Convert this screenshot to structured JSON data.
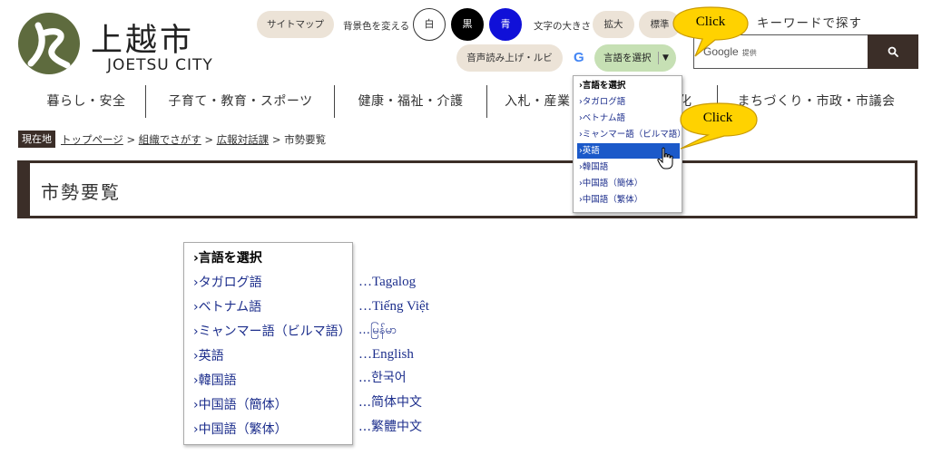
{
  "logo": {
    "kanji": "上越市",
    "roman": "JOETSU CITY"
  },
  "top": {
    "sitemap": "サイトマップ",
    "bg_label": "背景色を変える",
    "bg_white": "白",
    "bg_black": "黒",
    "bg_blue": "青",
    "font_label": "文字の大きさ",
    "font_large": "拡大",
    "font_standard": "標準",
    "voice": "音声読み上げ・ルビ",
    "keyword_label": "キーワードで探す",
    "search_brand": "Google",
    "search_provided": "提供",
    "lang_select": "言語を選択",
    "lang_caret": "▼"
  },
  "dropdown_small": {
    "options": [
      "›言語を選択",
      "›タガログ語",
      "›ベトナム語",
      "›ミャンマー語（ビルマ語）",
      "›英語",
      "›韓国語",
      "›中国語（簡体）",
      "›中国語（繁体）"
    ],
    "selected": "›英語"
  },
  "nav": {
    "items": [
      "暮らし・安全",
      "子育て・教育・スポーツ",
      "健康・福祉・介護",
      "入札・産業",
      "化",
      "まちづくり・市政・市議会"
    ]
  },
  "breadcrumb": {
    "badge": "現在地",
    "items": [
      "トップページ",
      "組織でさがす",
      "広報対話課"
    ],
    "separator": ">",
    "current": "市勢要覧"
  },
  "page_title": "市勢要覧",
  "dropdown_large": {
    "options": [
      "›言語を選択",
      "›タガログ語",
      "›ベトナム語",
      "›ミャンマー語（ビルマ語）",
      "›英語",
      "›韓国語",
      "›中国語（簡体）",
      "›中国語（繁体）"
    ]
  },
  "translations": [
    "…Tagalog",
    "…Tiếng Việt",
    "…မြန်မာ",
    "…English",
    "…한국어",
    "…简体中文",
    "…繁體中文"
  ],
  "callouts": [
    "Click",
    "Click"
  ],
  "colors": {
    "brand_dark": "#3b2e28",
    "logo_green": "#5e6b3e",
    "pill_beige": "#ece3d7",
    "lang_pill_green": "#c6e0b4",
    "selection_blue": "#1b59c9",
    "link_navy": "#1c2e8c",
    "callout_yellow": "#ffd200"
  }
}
